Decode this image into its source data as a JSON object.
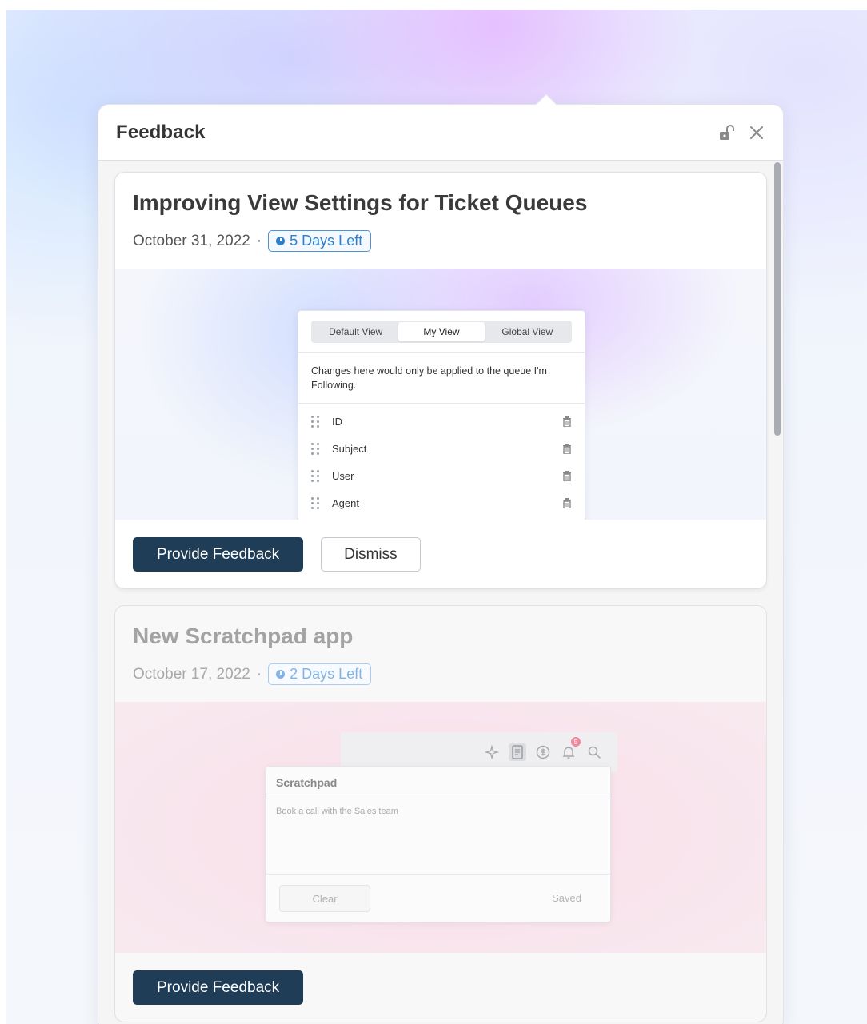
{
  "panel": {
    "title": "Feedback"
  },
  "cards": [
    {
      "title": "Improving View Settings for Ticket Queues",
      "date": "October 31, 2022",
      "separator": "·",
      "badge": "5 Days Left",
      "preview": {
        "tabs": [
          "Default View",
          "My View",
          "Global View"
        ],
        "active_tab": "My View",
        "note": "Changes here would only be applied to the queue I'm Following.",
        "rows": [
          "ID",
          "Subject",
          "User",
          "Agent"
        ]
      },
      "primary_label": "Provide Feedback",
      "secondary_label": "Dismiss"
    },
    {
      "title": "New Scratchpad app",
      "date": "October 17, 2022",
      "separator": "·",
      "badge": "2 Days Left",
      "preview": {
        "notification_count": "5",
        "scratchpad_title": "Scratchpad",
        "scratchpad_text": "Book a call with the Sales team",
        "clear_label": "Clear",
        "status": "Saved"
      },
      "primary_label": "Provide Feedback"
    }
  ],
  "colors": {
    "primary_button": "#1f3d56",
    "badge": "#2f7ec9"
  }
}
